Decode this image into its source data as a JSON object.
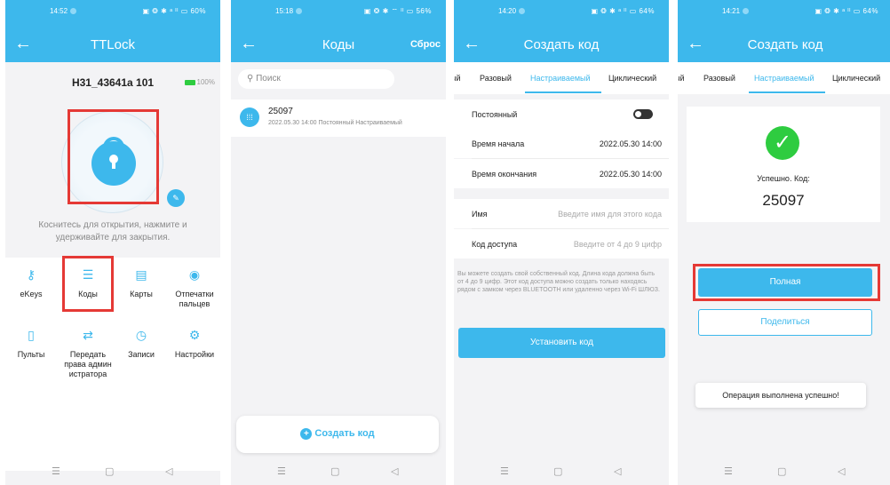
{
  "colors": {
    "accent": "#3db8ec",
    "highlight": "#e53935",
    "success": "#2ecc40"
  },
  "screens": {
    "s1": {
      "status": {
        "time": "14:52",
        "icons": "▣ ❂ ✱ ᵃ ᴵᴵ ▭ 60%"
      },
      "title": "TTLock",
      "lock_name": "H31_43641a 101",
      "battery": "100%",
      "hint": "Коснитесь для открытия, нажмите и удерживайте для закрытия.",
      "grid": [
        {
          "icon": "key-icon",
          "glyph": "⚷",
          "label": "eKeys"
        },
        {
          "icon": "codes-icon",
          "glyph": "☰",
          "label": "Коды"
        },
        {
          "icon": "card-icon",
          "glyph": "▤",
          "label": "Карты"
        },
        {
          "icon": "fingerprint-icon",
          "glyph": "◉",
          "label": "Отпечатки пальцев"
        },
        {
          "icon": "remote-icon",
          "glyph": "▯",
          "label": "Пульты"
        },
        {
          "icon": "transfer-icon",
          "glyph": "⇄",
          "label": "Передать права админ истратора"
        },
        {
          "icon": "records-icon",
          "glyph": "◷",
          "label": "Записи"
        },
        {
          "icon": "settings-icon",
          "glyph": "⚙",
          "label": "Настройки"
        }
      ]
    },
    "s2": {
      "status": {
        "time": "15:18",
        "icons": "▣ ❂ ✱ ⌔ ᴵᴵ ▭ 56%"
      },
      "title": "Коды",
      "reset": "Сброс",
      "search_placeholder": "Поиск",
      "code": {
        "number": "25097",
        "meta": "2022.05.30 14:00   Постоянный   Настраиваемый"
      },
      "create": "Создать код"
    },
    "s3": {
      "status": {
        "time": "14:20",
        "icons": "▣ ❂ ✱ ᵃ ᴵᴵ ▭ 64%"
      },
      "title": "Создать код",
      "tabs": [
        "ый",
        "Разовый",
        "Настраиваемый",
        "Циклический"
      ],
      "permanent": "Постоянный",
      "start_label": "Время начала",
      "start_value": "2022.05.30 14:00",
      "end_label": "Время окончания",
      "end_value": "2022.05.30 14:00",
      "name_label": "Имя",
      "name_placeholder": "Введите имя для этого кода",
      "code_label": "Код доступа",
      "code_placeholder": "Введите от 4 до 9 цифр",
      "note": "Вы можете создать свой собственный код. Длина кода должна быть от 4 до 9 цифр. Этот код доступа можно создать только находясь рядом с замком через BLUETOOTH или удаленно через Wi-Fi ШЛЮЗ.",
      "submit": "Установить код"
    },
    "s4": {
      "status": {
        "time": "14:21",
        "icons": "▣ ❂ ✱ ᵃ ᴵᴵ ▭ 64%"
      },
      "title": "Создать код",
      "tabs": [
        "ый",
        "Разовый",
        "Настраиваемый",
        "Циклический"
      ],
      "success": "Успешно. Код:",
      "code": "25097",
      "full": "Полная",
      "share": "Поделиться",
      "toast": "Операция выполнена успешно!"
    }
  },
  "sysnav": {
    "menu": "☰",
    "home": "▢",
    "back": "◁"
  }
}
